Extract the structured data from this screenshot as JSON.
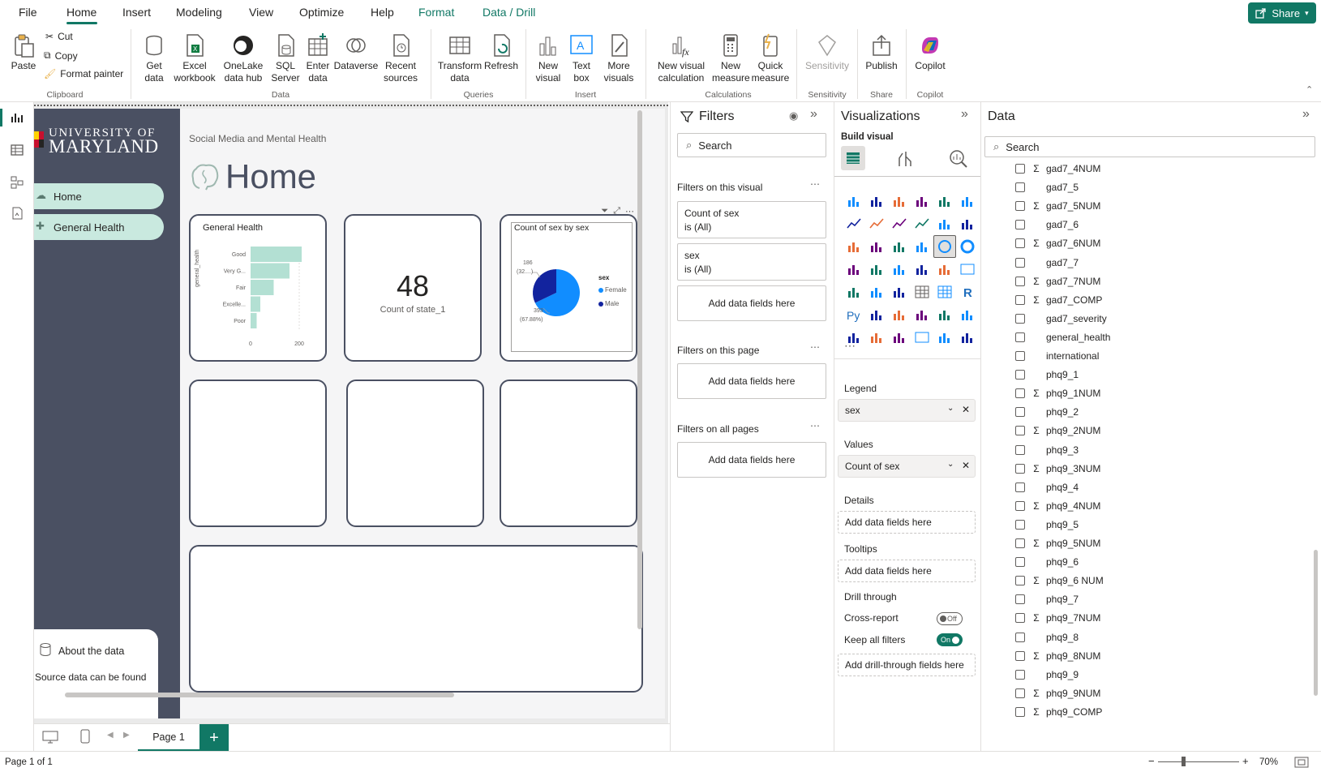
{
  "menu": {
    "items": [
      "File",
      "Home",
      "Insert",
      "Modeling",
      "View",
      "Optimize",
      "Help",
      "Format",
      "Data / Drill"
    ],
    "share": "Share"
  },
  "ribbon": {
    "clipboard": {
      "paste": "Paste",
      "cut": "Cut",
      "copy": "Copy",
      "format_painter": "Format painter",
      "label": "Clipboard"
    },
    "data": {
      "get_data": "Get data",
      "excel": "Excel workbook",
      "onelake": "OneLake data hub",
      "sql": "SQL Server",
      "enter": "Enter data",
      "dataverse": "Dataverse",
      "recent": "Recent sources",
      "label": "Data"
    },
    "queries": {
      "transform": "Transform data",
      "refresh": "Refresh",
      "label": "Queries"
    },
    "insert": {
      "new_visual": "New visual",
      "text_box": "Text box",
      "more_visuals": "More visuals",
      "label": "Insert"
    },
    "calculations": {
      "new_visual_calc": "New visual calculation",
      "new_measure": "New measure",
      "quick_measure": "Quick measure",
      "label": "Calculations"
    },
    "sensitivity": {
      "sensitivity": "Sensitivity",
      "label": "Sensitivity"
    },
    "share": {
      "publish": "Publish",
      "label": "Share"
    },
    "copilot": {
      "copilot": "Copilot",
      "label": "Copilot"
    }
  },
  "report": {
    "university_line1": "UNIVERSITY OF",
    "university_line2": "MARYLAND",
    "subtitle": "Social Media and Mental Health",
    "title": "Home",
    "nav": [
      "Home",
      "General Health"
    ],
    "about_title": "About the data",
    "about_text": "Source data can be found here, click below",
    "card_general_health": {
      "title": "General Health",
      "axis_label": "general_health",
      "categories": [
        "Good",
        "Very G...",
        "Fair",
        "Excelle...",
        "Poor"
      ],
      "ticks": [
        "0",
        "200"
      ]
    },
    "card_count": {
      "value": "48",
      "label": "Count of state_1"
    },
    "card_pie": {
      "title": "Count of sex by sex",
      "legend_title": "sex",
      "legend": [
        "Female",
        "Male"
      ],
      "label_male": "186",
      "label_male_pct": "(32....)",
      "label_female": "393",
      "label_female_pct": "(67.88%)"
    }
  },
  "chart_data": [
    {
      "type": "bar",
      "title": "General Health",
      "ylabel": "general_health",
      "categories": [
        "Good",
        "Very G...",
        "Fair",
        "Excelle...",
        "Poor"
      ],
      "values": [
        210,
        160,
        95,
        40,
        25
      ],
      "xlim": [
        0,
        250
      ]
    },
    {
      "type": "pie",
      "title": "Count of sex by sex",
      "categories": [
        "Female",
        "Male"
      ],
      "values": [
        393,
        186
      ],
      "colors": [
        "#118dff",
        "#12239e"
      ]
    }
  ],
  "page_tabs": {
    "page1": "Page 1"
  },
  "status": {
    "page": "Page 1 of 1",
    "zoom": "70%"
  },
  "filters": {
    "title": "Filters",
    "search": "Search",
    "on_visual": "Filters on this visual",
    "f1_name": "Count of sex",
    "f1_state": "is (All)",
    "f2_name": "sex",
    "f2_state": "is (All)",
    "add": "Add data fields here",
    "on_page": "Filters on this page",
    "on_all": "Filters on all pages"
  },
  "visualizations": {
    "title": "Visualizations",
    "build": "Build visual",
    "legend": "Legend",
    "legend_field": "sex",
    "values": "Values",
    "values_field": "Count of sex",
    "details": "Details",
    "tooltips": "Tooltips",
    "add": "Add data fields here",
    "drill": "Drill through",
    "cross_report": "Cross-report",
    "cross_state": "Off",
    "keep_filters": "Keep all filters",
    "keep_state": "On",
    "add_drill": "Add drill-through fields here"
  },
  "data_pane": {
    "title": "Data",
    "search": "Search",
    "fields": [
      {
        "name": "gad7_4NUM",
        "sigma": true
      },
      {
        "name": "gad7_5",
        "sigma": false
      },
      {
        "name": "gad7_5NUM",
        "sigma": true
      },
      {
        "name": "gad7_6",
        "sigma": false
      },
      {
        "name": "gad7_6NUM",
        "sigma": true
      },
      {
        "name": "gad7_7",
        "sigma": false
      },
      {
        "name": "gad7_7NUM",
        "sigma": true
      },
      {
        "name": "gad7_COMP",
        "sigma": true
      },
      {
        "name": "gad7_severity",
        "sigma": false
      },
      {
        "name": "general_health",
        "sigma": false
      },
      {
        "name": "international",
        "sigma": false
      },
      {
        "name": "phq9_1",
        "sigma": false
      },
      {
        "name": "phq9_1NUM",
        "sigma": true
      },
      {
        "name": "phq9_2",
        "sigma": false
      },
      {
        "name": "phq9_2NUM",
        "sigma": true
      },
      {
        "name": "phq9_3",
        "sigma": false
      },
      {
        "name": "phq9_3NUM",
        "sigma": true
      },
      {
        "name": "phq9_4",
        "sigma": false
      },
      {
        "name": "phq9_4NUM",
        "sigma": true
      },
      {
        "name": "phq9_5",
        "sigma": false
      },
      {
        "name": "phq9_5NUM",
        "sigma": true
      },
      {
        "name": "phq9_6",
        "sigma": false
      },
      {
        "name": "phq9_6 NUM",
        "sigma": true
      },
      {
        "name": "phq9_7",
        "sigma": false
      },
      {
        "name": "phq9_7NUM",
        "sigma": true
      },
      {
        "name": "phq9_8",
        "sigma": false
      },
      {
        "name": "phq9_8NUM",
        "sigma": true
      },
      {
        "name": "phq9_9",
        "sigma": false
      },
      {
        "name": "phq9_9NUM",
        "sigma": true
      },
      {
        "name": "phq9_COMP",
        "sigma": true
      }
    ]
  },
  "colors": {
    "accent": "#117865",
    "nav_bg": "#4a5062",
    "nav_btn": "#c9e9df",
    "bar": "#b3e0d3",
    "female": "#118dff",
    "male": "#12239e"
  }
}
